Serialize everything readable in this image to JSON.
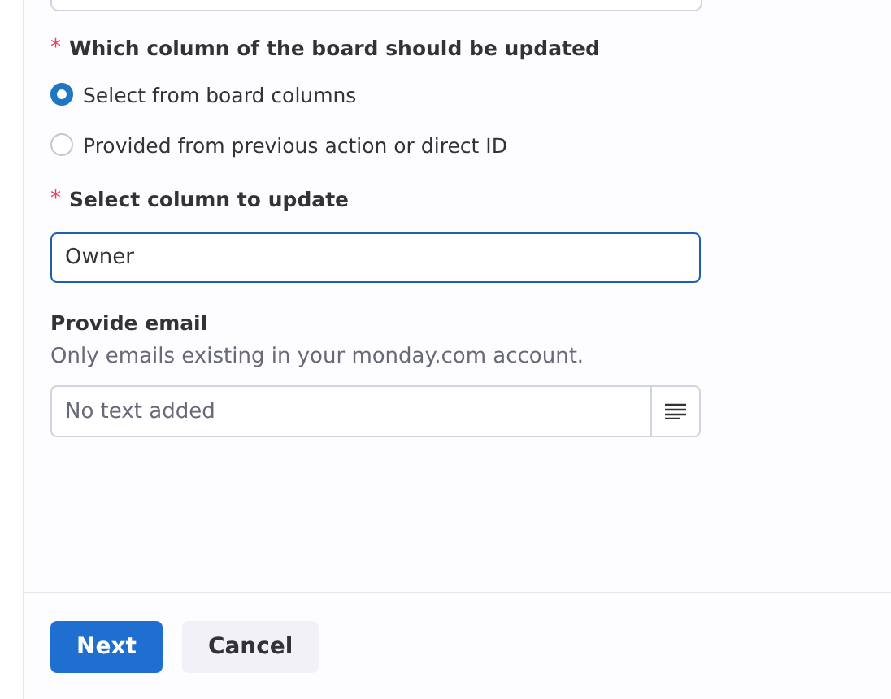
{
  "top_field": {
    "kind": "field"
  },
  "column_question": {
    "required_mark": "*",
    "label": "Which column of the board should be updated"
  },
  "column_source_options": [
    {
      "label": "Select from board columns",
      "selected": true
    },
    {
      "label": "Provided from previous action or direct ID",
      "selected": false
    }
  ],
  "column_select": {
    "required_mark": "*",
    "label": "Select column to update",
    "value": "Owner"
  },
  "email": {
    "label": "Provide email",
    "help": "Only emails existing in your monday.com account.",
    "placeholder": "No text added"
  },
  "buttons": [
    {
      "label": "Next",
      "kind": "primary"
    },
    {
      "label": "Cancel",
      "kind": "secondary"
    }
  ]
}
